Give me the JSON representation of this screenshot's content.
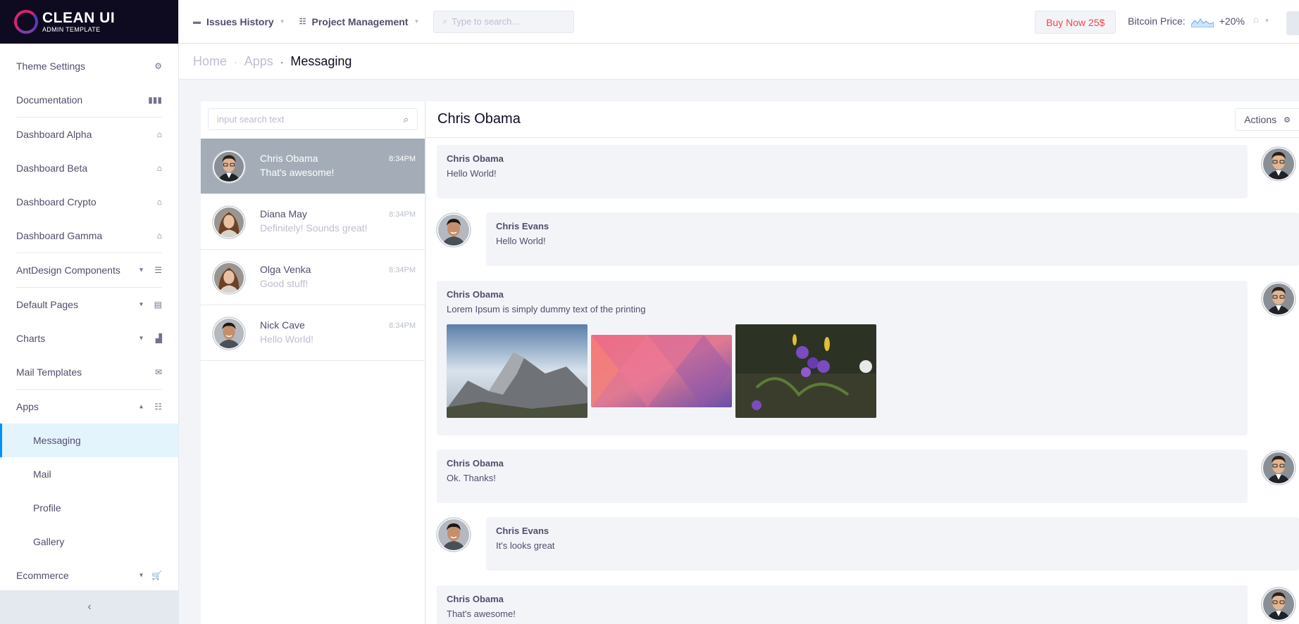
{
  "logo": {
    "title": "CLEAN UI",
    "subtitle": "ADMIN TEMPLATE"
  },
  "sidebar": {
    "items": [
      {
        "label": "Theme Settings",
        "icon": "gear-icon"
      },
      {
        "label": "Documentation",
        "icon": "books-icon"
      },
      {
        "label": "Dashboard Alpha",
        "icon": "home-icon"
      },
      {
        "label": "Dashboard Beta",
        "icon": "home-icon"
      },
      {
        "label": "Dashboard Crypto",
        "icon": "home-icon"
      },
      {
        "label": "Dashboard Gamma",
        "icon": "home-icon"
      },
      {
        "label": "AntDesign Components",
        "icon": "stack-icon"
      },
      {
        "label": "Default Pages",
        "icon": "page-icon"
      },
      {
        "label": "Charts",
        "icon": "chart-icon"
      },
      {
        "label": "Mail Templates",
        "icon": "mail-icon"
      },
      {
        "label": "Apps",
        "icon": "database-icon"
      },
      {
        "label": "Messaging"
      },
      {
        "label": "Mail"
      },
      {
        "label": "Profile"
      },
      {
        "label": "Gallery"
      },
      {
        "label": "Ecommerce",
        "icon": "cart-icon"
      }
    ]
  },
  "topbar": {
    "issues": "Issues History",
    "project": "Project Management",
    "search_placeholder": "Type to search...",
    "buy": "Buy Now 25$",
    "btc_label": "Bitcoin Price:",
    "btc_change": "+20%"
  },
  "breadcrumbs": {
    "home": "Home",
    "apps": "Apps",
    "current": "Messaging"
  },
  "dialogs": {
    "search_placeholder": "input search text",
    "list": [
      {
        "name": "Chris Obama",
        "time": "8:34PM",
        "message": "That's awesome!"
      },
      {
        "name": "Diana May",
        "time": "8:34PM",
        "message": "Definitely! Sounds great!"
      },
      {
        "name": "Olga Venka",
        "time": "8:34PM",
        "message": "Good stuff!"
      },
      {
        "name": "Nick Cave",
        "time": "8:34PM",
        "message": "Hello World!"
      }
    ]
  },
  "chat": {
    "title": "Chris Obama",
    "actions": "Actions",
    "messages": [
      {
        "name": "Chris Obama",
        "text": "Hello World!"
      },
      {
        "name": "Chris Evans",
        "text": "Hello World!"
      },
      {
        "name": "Chris Obama",
        "text": "Lorem Ipsum is simply dummy text of the printing"
      },
      {
        "name": "Chris Obama",
        "text": "Ok. Thanks!"
      },
      {
        "name": "Chris Evans",
        "text": "It's looks great"
      },
      {
        "name": "Chris Obama",
        "text": "That's awesome!"
      }
    ]
  },
  "colors": {
    "accent": "#0190fe",
    "danger": "#fb434a",
    "selected_dialog": "#a3acb7"
  }
}
